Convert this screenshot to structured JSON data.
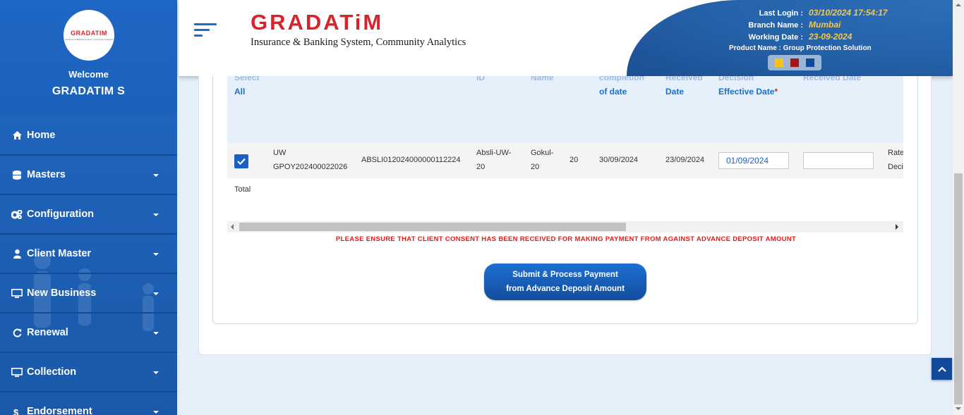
{
  "sidebar": {
    "logo_text": "GRADATIM",
    "logo_sub": "Insurance & Banking System, Community Analytics",
    "welcome": "Welcome",
    "username": "GRADATIM S",
    "items": [
      {
        "label": "Home",
        "icon": "home-icon",
        "has_caret": false
      },
      {
        "label": "Masters",
        "icon": "database-icon",
        "has_caret": true
      },
      {
        "label": "Configuration",
        "icon": "gears-icon",
        "has_caret": true
      },
      {
        "label": "Client Master",
        "icon": "user-icon",
        "has_caret": true
      },
      {
        "label": "New Business",
        "icon": "monitor-icon",
        "has_caret": true
      },
      {
        "label": "Renewal",
        "icon": "refresh-icon",
        "has_caret": true
      },
      {
        "label": "Collection",
        "icon": "monitor-icon",
        "has_caret": true
      },
      {
        "label": "Endorsement",
        "icon": "dollar-icon",
        "has_caret": true
      }
    ]
  },
  "header": {
    "brand_title": "GRADATiM",
    "brand_sub": "Insurance & Banking System, Community Analytics",
    "last_login_label": "Last Login :",
    "last_login_value": "03/10/2024 17:54:17",
    "branch_label": "Branch Name :",
    "branch_value": "Mumbai",
    "working_date_label": "Working Date :",
    "working_date_value": "23-09-2024",
    "product_label": "Product Name : Group Protection Solution",
    "theme_colors": [
      "#f6c31c",
      "#a01818",
      "#12499a"
    ]
  },
  "table": {
    "headers": {
      "select_top": "Select",
      "select_bottom": "All",
      "id": "ID",
      "name": "Name",
      "completion_top": "completion",
      "completion_bottom": "of date",
      "received_top": "Received",
      "received_bottom": "Date",
      "decision_top": "Decision",
      "decision_bottom": "Effective Date",
      "required_mark": "*",
      "received_date2": "Received Date"
    },
    "row": {
      "uw_line1": "UW",
      "uw_line2": "GPOY202400022026",
      "policy_no": "ABSLI012024000000112224",
      "id_line1": "Absli-UW-",
      "id_line2": "20",
      "name_line1": "Gokul-",
      "name_line2": "20",
      "count": "20",
      "completion_date": "30/09/2024",
      "received_date": "23/09/2024",
      "decision_date": "01/09/2024",
      "received_date2": "",
      "last_line1": "Rate",
      "last_line2": "Deci"
    },
    "total_label": "Total"
  },
  "notice": "PLEASE ENSURE THAT CLIENT CONSENT HAS BEEN RECEIVED FOR MAKING PAYMENT FROM AGAINST ADVANCE DEPOSIT AMOUNT",
  "submit": {
    "line1": "Submit & Process Payment",
    "line2": "from Advance Deposit Amount"
  }
}
